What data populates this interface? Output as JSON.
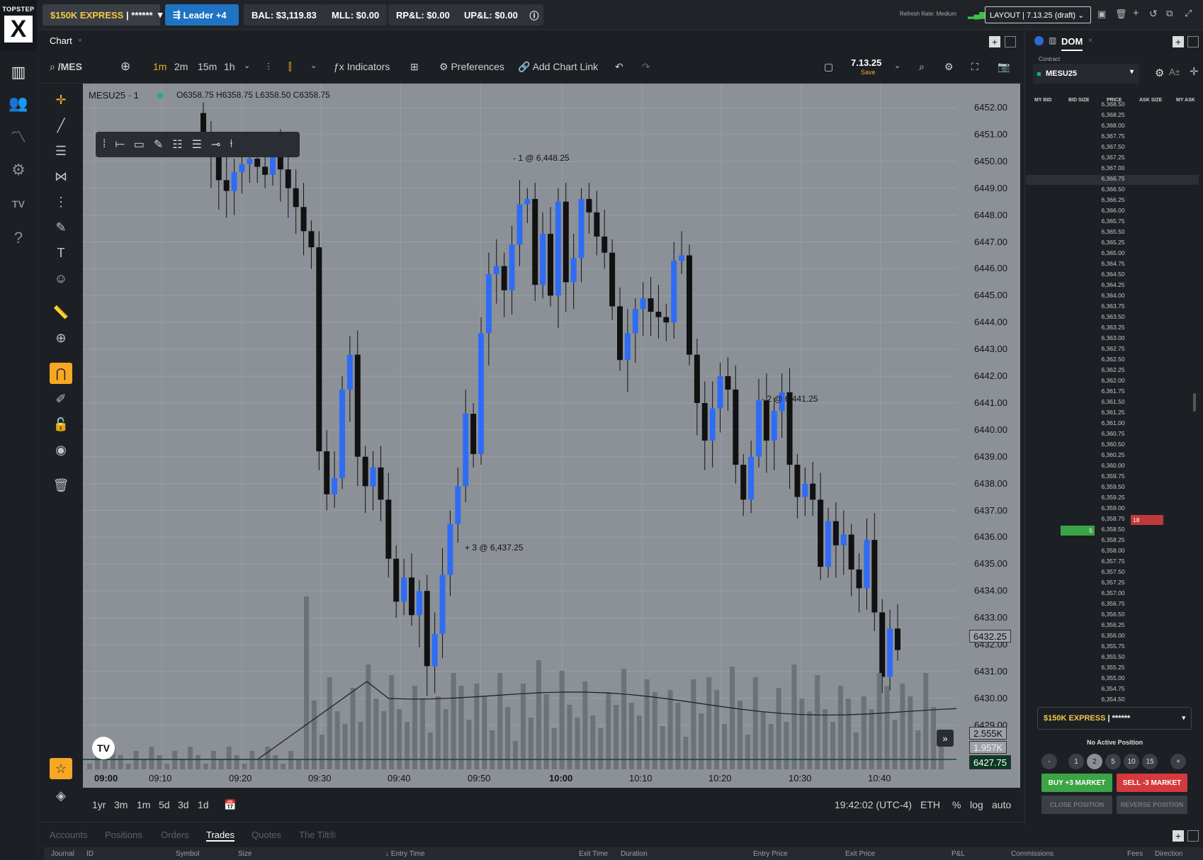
{
  "app": {
    "logo_text": "TOPSTEP",
    "logo_mark": "X"
  },
  "topbar": {
    "account": "$150K EXPRESS",
    "account_mask": "| ******",
    "leader": "Leader +4",
    "balance": "BAL: $3,119.83",
    "mll": "MLL: $0.00",
    "rpl": "RP&L: $0.00",
    "upl": "UP&L: $0.00",
    "refresh": "Refresh Rate: Medium",
    "layout": "LAYOUT | 7.13.25 (draft)"
  },
  "chart_panel": {
    "tab": "Chart",
    "symbol_search": "/MES",
    "timeframes": [
      "1m",
      "2m",
      "15m",
      "1h"
    ],
    "active_timeframe": "1m",
    "indicators": "Indicators",
    "preferences": "Preferences",
    "add_chart_link": "Add Chart Link",
    "layout_name": "7.13.25",
    "layout_save": "Save"
  },
  "legend": {
    "symbol": "MESU25",
    "interval": "1",
    "ohlc": "O6358.75 H6358.75 L6358.50 C6358.75"
  },
  "chart_data": {
    "type": "candlestick",
    "symbol": "MESU25",
    "y_ticks": [
      "6452.00",
      "6451.00",
      "6450.00",
      "6449.00",
      "6448.00",
      "6447.00",
      "6446.00",
      "6445.00",
      "6444.00",
      "6443.00",
      "6442.00",
      "6441.00",
      "6440.00",
      "6439.00",
      "6438.00",
      "6437.00",
      "6436.00",
      "6435.00",
      "6434.00",
      "6433.00",
      "6432.00",
      "6431.00",
      "6430.00",
      "6429.00"
    ],
    "x_ticks": [
      "09:00",
      "09:10",
      "09:20",
      "09:30",
      "09:40",
      "09:50",
      "10:00",
      "10:10",
      "10:20",
      "10:30",
      "10:40"
    ],
    "ylim": [
      6428.6,
      6453.1
    ],
    "price_labels": {
      "last": "6432.25",
      "vol_a": "2.555K",
      "vol_b": "1.957K",
      "current": "6427.75"
    },
    "annotations": [
      "- 1 @ 6,448.25",
      "+ 3 @ 6,437.25",
      "- 2 @ 6,441.25"
    ],
    "up_color": "#2f6cf5",
    "down_color": "#111111"
  },
  "timebar": {
    "ranges": [
      "1yr",
      "3m",
      "1m",
      "5d",
      "3d",
      "1d"
    ],
    "clock": "19:42:02 (UTC-4)",
    "session": "ETH",
    "pct": "%",
    "log": "log",
    "auto": "auto"
  },
  "bottom": {
    "tabs": [
      "Accounts",
      "Positions",
      "Orders",
      "Trades",
      "Quotes",
      "The Tilt®"
    ],
    "active_tab": "Trades",
    "columns": [
      "Journal",
      "ID",
      "Symbol",
      "Size",
      "Entry Time",
      "Exit Time",
      "Duration",
      "Entry Price",
      "Exit Price",
      "P&L",
      "Commissions",
      "Fees",
      "Direction"
    ]
  },
  "dom": {
    "tab": "DOM",
    "contract_label": "Contract",
    "contract": "MESU25",
    "headers": [
      "MY BID",
      "BID SIZE",
      "PRICE",
      "ASK SIZE",
      "MY ASK"
    ],
    "levels": [
      "6,368.50",
      "6,368.25",
      "6,368.00",
      "6,367.75",
      "6,367.50",
      "6,367.25",
      "6,367.00",
      "6,366.75",
      "6,366.50",
      "6,366.25",
      "6,366.00",
      "6,365.75",
      "6,365.50",
      "6,365.25",
      "6,365.00",
      "6,364.75",
      "6,364.50",
      "6,364.25",
      "6,364.00",
      "6,363.75",
      "6,363.50",
      "6,363.25",
      "6,363.00",
      "6,362.75",
      "6,362.50",
      "6,362.25",
      "6,362.00",
      "6,361.75",
      "6,361.50",
      "6,361.25",
      "6,361.00",
      "6,360.75",
      "6,360.50",
      "6,360.25",
      "6,360.00",
      "6,359.75",
      "6,359.50",
      "6,359.25",
      "6,359.00",
      "6,358.75",
      "6,358.50",
      "6,358.25",
      "6,358.00",
      "6,357.75",
      "6,357.50",
      "6,357.25",
      "6,357.00",
      "6,356.75",
      "6,356.50",
      "6,356.25",
      "6,356.00",
      "6,355.75",
      "6,355.50",
      "6,355.25",
      "6,355.00",
      "6,354.75",
      "6,354.50"
    ],
    "ask_size": "18",
    "bid_size": "5",
    "account": "$150K EXPRESS",
    "account_mask": "| ******",
    "position": "No Active Position",
    "qty": [
      "-",
      "1",
      "2",
      "5",
      "10",
      "15",
      "+"
    ],
    "buy": "BUY +3 MARKET",
    "sell": "SELL -3 MARKET",
    "close": "CLOSE POSITION",
    "reverse": "REVERSE POSITION"
  }
}
